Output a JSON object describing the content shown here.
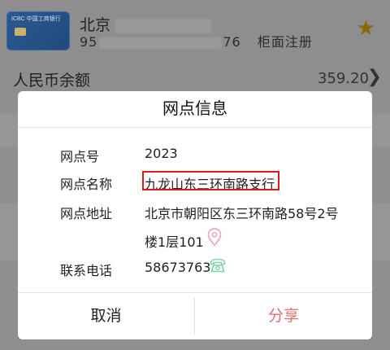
{
  "background": {
    "card": {
      "brand_text": "ICBC 中国工商银行",
      "title": "北京",
      "number_prefix": "95",
      "number_suffix": "76",
      "register_type": "柜面注册"
    },
    "balance": {
      "label": "人民币余额",
      "value": "359.20"
    }
  },
  "dialog": {
    "title": "网点信息",
    "rows": [
      {
        "label": "网点号",
        "value": "2023"
      },
      {
        "label": "网点名称",
        "value": "九龙山东三环南路支行"
      },
      {
        "label": "网点地址",
        "value": "北京市朝阳区东三环南路58号2号",
        "value_line2": "楼1层101"
      },
      {
        "label": "联系电话",
        "value": "58673763"
      }
    ],
    "buttons": {
      "cancel": "取消",
      "share": "分享"
    }
  },
  "colors": {
    "highlight_border": "#e01919",
    "share_text": "#e26f6f",
    "pin_icon": "#f0a7c0",
    "phone_icon": "#7fd3ad",
    "overlay": "#8f8f8f"
  },
  "icons": [
    "star-icon",
    "chevron-right-icon",
    "map-pin-icon",
    "phone-icon"
  ]
}
